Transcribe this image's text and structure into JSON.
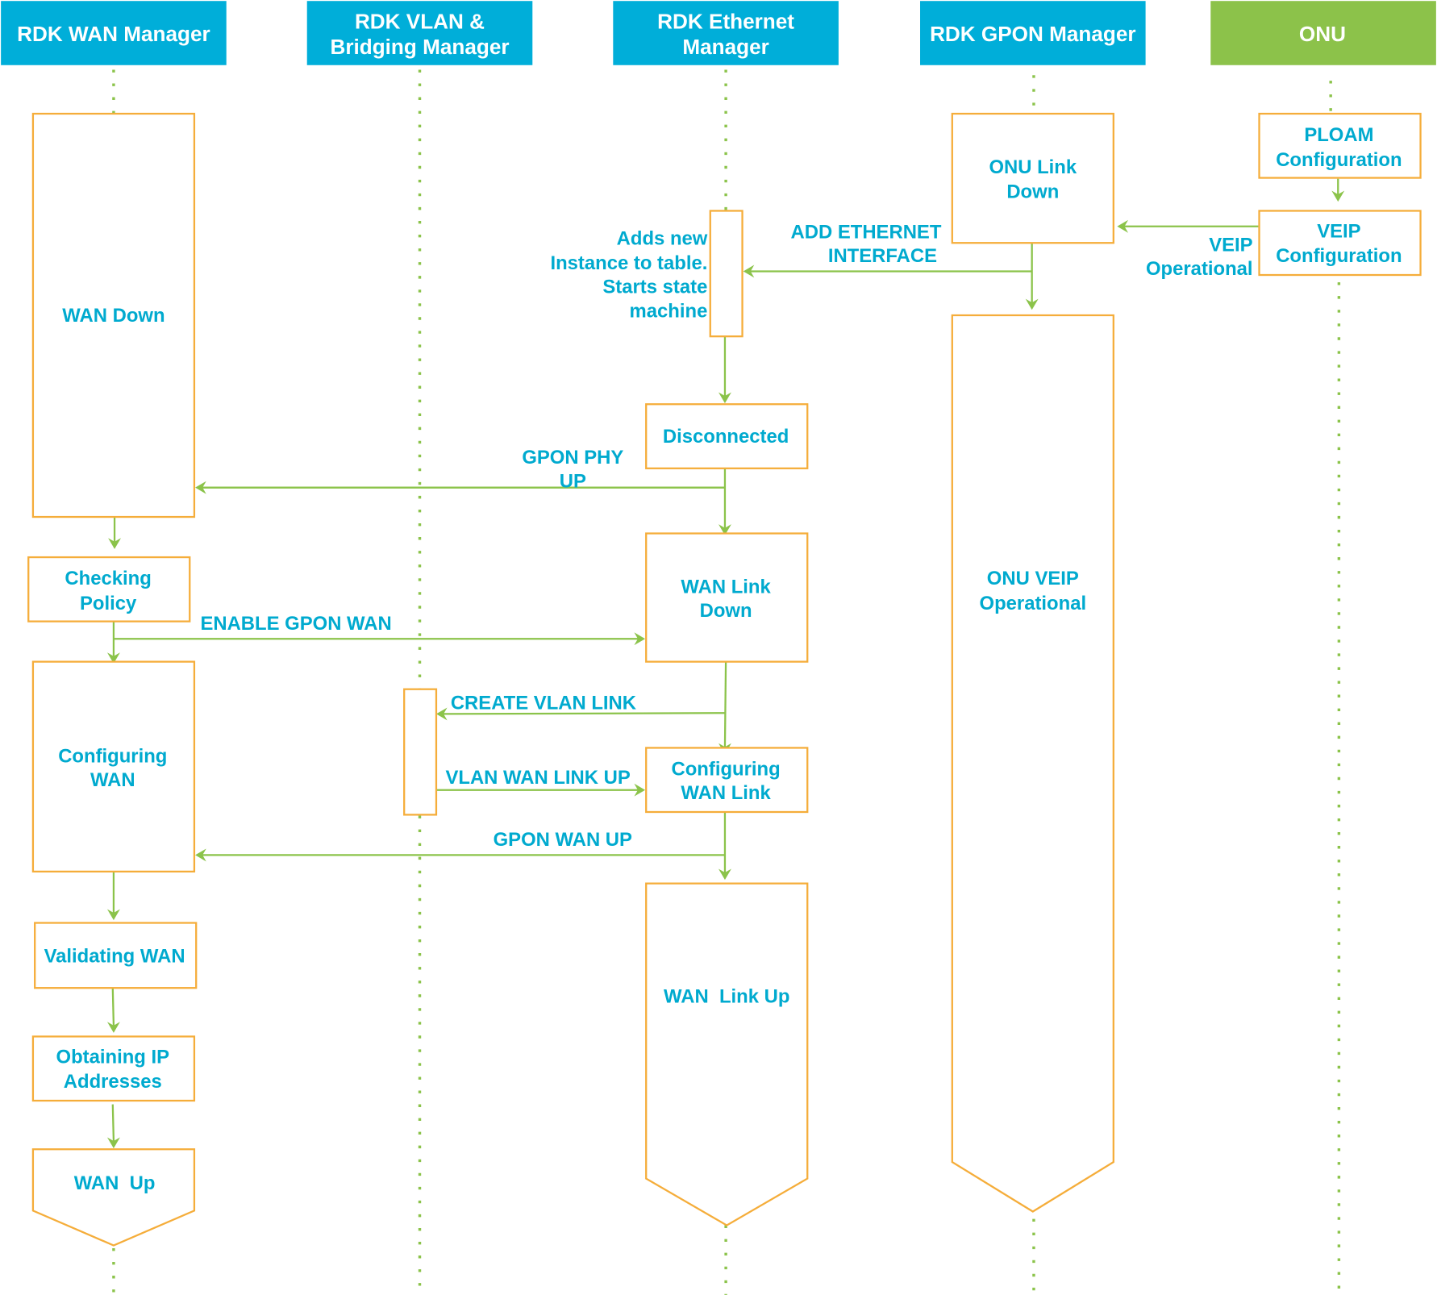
{
  "colors": {
    "header_blue": "#00AED9",
    "onu_green": "#8CC24A",
    "state_border": "#F5AD3A",
    "arrow_green": "#8BC34A",
    "text_blue": "#00AACF"
  },
  "lanes": [
    {
      "id": "wan",
      "label": [
        "RDK WAN Manager"
      ]
    },
    {
      "id": "vlan",
      "label": [
        "RDK VLAN &",
        "Bridging Manager"
      ]
    },
    {
      "id": "eth",
      "label": [
        "RDK Ethernet",
        "Manager"
      ]
    },
    {
      "id": "gpon",
      "label": [
        "RDK GPON Manager"
      ]
    },
    {
      "id": "onu",
      "label": [
        "ONU"
      ]
    }
  ],
  "states": {
    "wan_down": [
      "WAN Down"
    ],
    "checking_policy": [
      "Checking",
      "Policy"
    ],
    "configuring_wan": [
      "Configuring",
      "WAN"
    ],
    "validating_wan": [
      "Validating WAN"
    ],
    "obtaining_ip": [
      "Obtaining IP",
      "Addresses"
    ],
    "wan_up": [
      "WAN  Up"
    ],
    "disconnected": [
      "Disconnected"
    ],
    "wan_link_down": [
      "WAN Link",
      "Down"
    ],
    "configuring_wan_link": [
      "Configuring",
      "WAN Link"
    ],
    "wan_link_up": [
      "WAN  Link Up"
    ],
    "onu_link_down": [
      "ONU Link",
      "Down"
    ],
    "onu_veip_operational": [
      "ONU VEIP",
      "Operational"
    ],
    "ploam_configuration": [
      "PLOAM",
      "Configuration"
    ],
    "veip_configuration": [
      "VEIP",
      "Configuration"
    ]
  },
  "messages": {
    "add_ethernet_interface": [
      "ADD ETHERNET",
      "INTERFACE"
    ],
    "veip_operational": [
      "VEIP",
      "Operational"
    ],
    "adds_new_instance": [
      "Adds new",
      "Instance to table.",
      "Starts state",
      "machine"
    ],
    "gpon_phy_up": [
      "GPON PHY",
      "UP"
    ],
    "enable_gpon_wan": [
      "ENABLE GPON WAN"
    ],
    "create_vlan_link": [
      "CREATE VLAN LINK"
    ],
    "vlan_wan_link_up": [
      "VLAN WAN LINK UP"
    ],
    "gpon_wan_up": [
      "GPON WAN UP"
    ]
  }
}
